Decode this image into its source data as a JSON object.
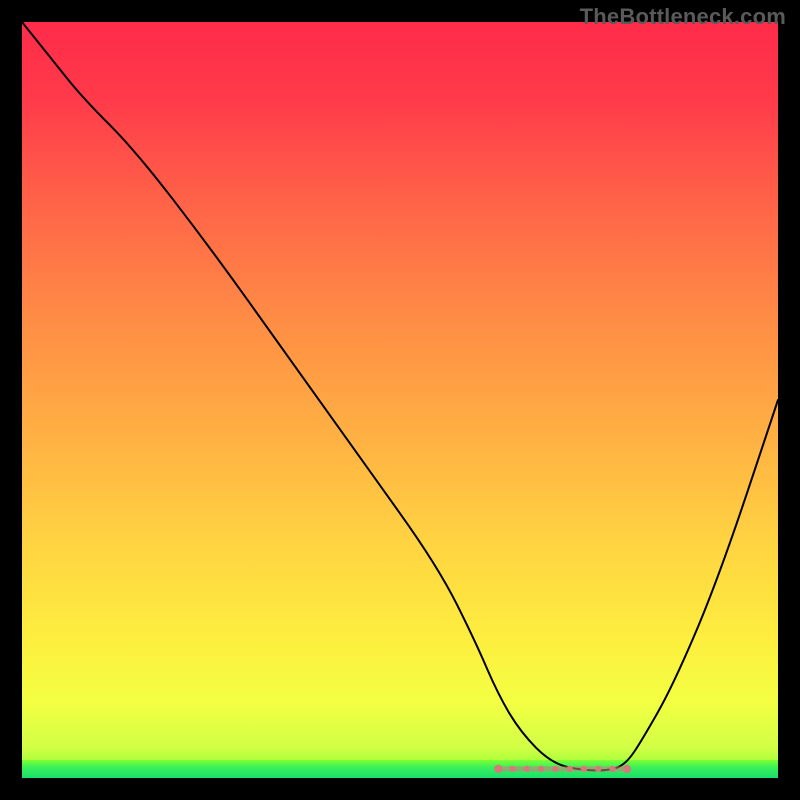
{
  "watermark": "TheBottleneck.com",
  "gradient_stops": [
    {
      "offset": 0.0,
      "color": "#ff2b4a"
    },
    {
      "offset": 0.1,
      "color": "#ff3a4a"
    },
    {
      "offset": 0.25,
      "color": "#ff6648"
    },
    {
      "offset": 0.4,
      "color": "#ff8e45"
    },
    {
      "offset": 0.55,
      "color": "#ffb143"
    },
    {
      "offset": 0.7,
      "color": "#ffd641"
    },
    {
      "offset": 0.82,
      "color": "#fdef3f"
    },
    {
      "offset": 0.9,
      "color": "#f3ff42"
    },
    {
      "offset": 0.96,
      "color": "#d1ff44"
    },
    {
      "offset": 1.0,
      "color": "#7fff33"
    }
  ],
  "chart_data": {
    "type": "line",
    "title": "",
    "xlabel": "",
    "ylabel": "",
    "xlim": [
      0,
      100
    ],
    "ylim": [
      0,
      100
    ],
    "grid": false,
    "series": [
      {
        "name": "bottleneck-curve",
        "color": "#000000",
        "x": [
          0,
          4,
          8,
          15,
          25,
          35,
          45,
          55,
          60,
          63,
          66,
          70,
          74,
          78,
          80,
          82,
          86,
          92,
          100
        ],
        "y": [
          100,
          95,
          90,
          83,
          70,
          56,
          42,
          28,
          18,
          11,
          6,
          2,
          1,
          1,
          2,
          5,
          12,
          26,
          50
        ]
      }
    ],
    "annotations": [
      {
        "name": "optimal-band",
        "type": "marker-band",
        "color": "#d47a7a",
        "x_start": 63,
        "x_end": 80,
        "y": 1.2
      }
    ]
  }
}
